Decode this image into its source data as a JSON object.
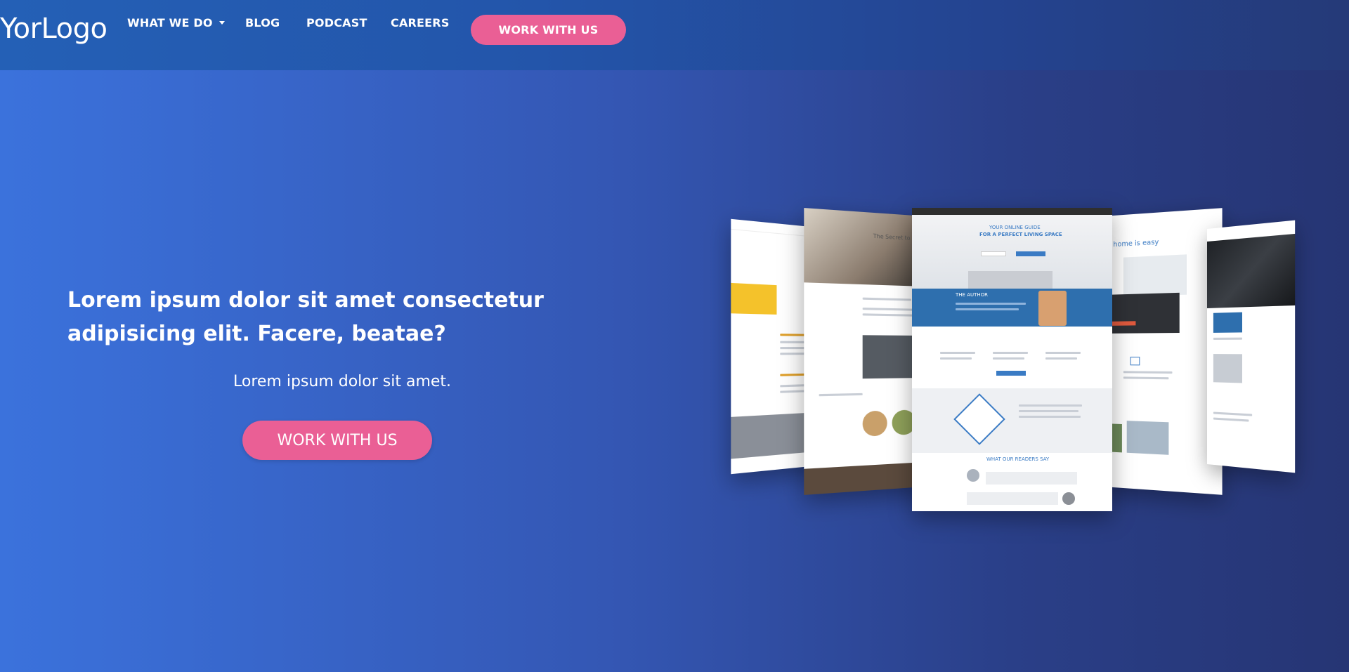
{
  "header": {
    "logo": "YorLogo",
    "nav": {
      "what_we_do": "WHAT WE DO",
      "blog": "BLOG",
      "podcast": "PODCAST",
      "careers": "CAREERS"
    },
    "cta_label": "WORK WITH US"
  },
  "hero": {
    "title": "Lorem ipsum dolor sit amet consectetur adipisicing elit. Facere, beatae?",
    "subtitle": "Lorem ipsum dolor sit amet.",
    "cta_label": "WORK WITH US"
  },
  "gallery": {
    "image_description": "website template mockups fanned out",
    "center_mock": {
      "heading_line1": "YOUR ONLINE GUIDE",
      "heading_line2": "FOR A PERFECT LIVING SPACE",
      "author_label": "THE AUTHOR",
      "readers_label": "WHAT OUR READERS SAY"
    },
    "left_mock_heading": "The Secret to Fresh",
    "right_mock_heading": "home is easy"
  },
  "colors": {
    "accent_pink": "#ea5f95",
    "nav_blue": "#2460b6",
    "bg_left": "#3b72dc",
    "bg_right": "#263574"
  }
}
